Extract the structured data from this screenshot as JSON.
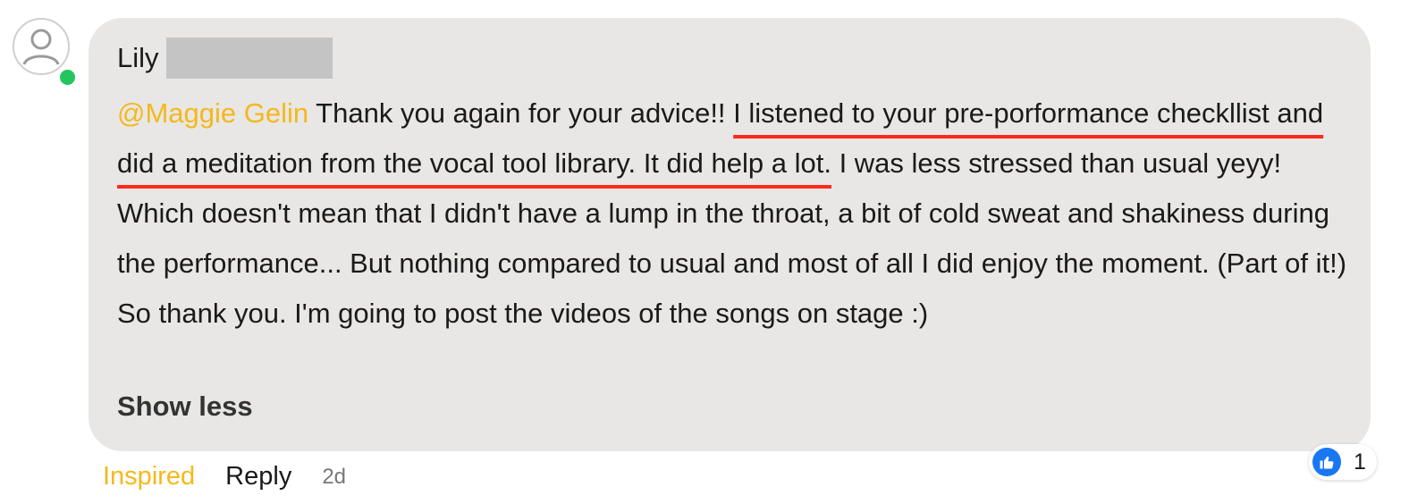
{
  "comment": {
    "author": {
      "first_name": "Lily"
    },
    "body": {
      "mention": "@Maggie Gelin",
      "part1": " Thank you again for your advice!! ",
      "highlighted": "I listened to your pre-porformance checkllist and did a meditation from the vocal tool library. It did help a lot.",
      "part2": " I was less stressed than usual yeyy! Which doesn't mean that I didn't have a lump in the throat, a bit of cold sweat and shakiness during the performance... But nothing compared to usual and most of all I did enjoy the moment. (Part of it!) So thank you. I'm going to post the videos of the songs on stage :)"
    },
    "show_less_label": "Show less",
    "actions": {
      "inspired_label": "Inspired",
      "reply_label": "Reply",
      "timestamp": "2d"
    },
    "reaction": {
      "icon": "thumbs-up-icon",
      "count": "1"
    }
  },
  "colors": {
    "mention": "#f5b81c",
    "highlight_underline": "#ff2a1a",
    "bubble_bg": "#e8e7e5",
    "online": "#22c55e",
    "like": "#1877f2"
  }
}
